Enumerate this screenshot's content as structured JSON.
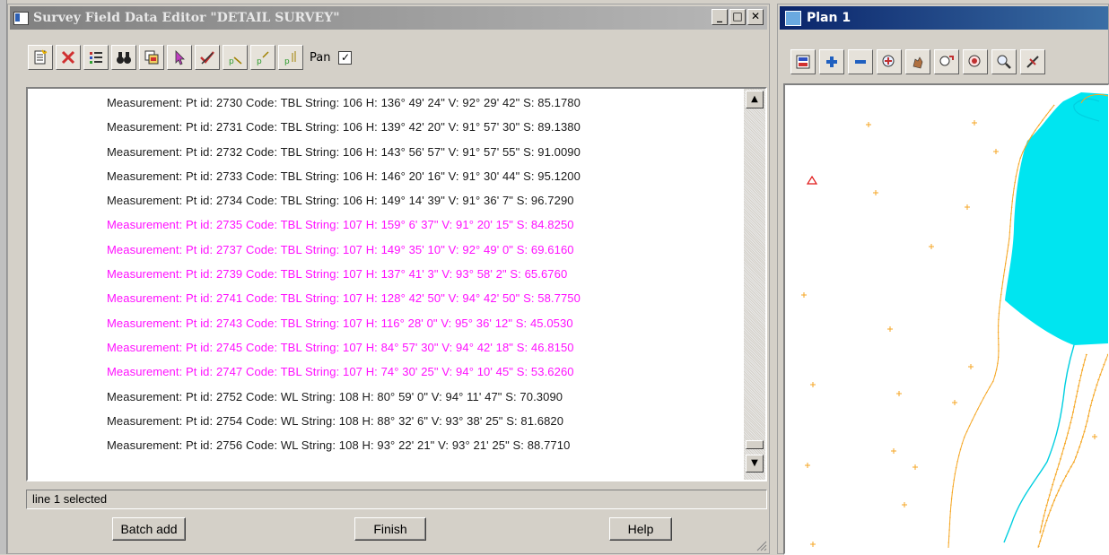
{
  "editor": {
    "title": "Survey Field Data Editor \"DETAIL SURVEY\"",
    "window_buttons": {
      "minimize": "_",
      "maximize": "□",
      "close": "✕"
    },
    "toolbar": {
      "buttons": [
        "new-icon",
        "delete-icon",
        "list-icon",
        "binoculars-icon",
        "copy-icon",
        "cursor-icon",
        "check-icon",
        "point-icon",
        "point-edit-icon",
        "point-chart-icon"
      ],
      "pan_label": "Pan",
      "pan_checked": "✓"
    },
    "rows": [
      {
        "text": "Measurement:  Pt id: 2730 Code: TBL String: 106 H:  136° 49' 24\" V:   92° 29' 42\" S: 85.1780",
        "color": "black"
      },
      {
        "text": "Measurement:  Pt id: 2731 Code: TBL String: 106 H:  139° 42' 20\" V:   91° 57' 30\" S: 89.1380",
        "color": "black"
      },
      {
        "text": "Measurement:  Pt id: 2732 Code: TBL String: 106 H:  143° 56' 57\" V:   91° 57' 55\" S: 91.0090",
        "color": "black"
      },
      {
        "text": "Measurement:  Pt id: 2733 Code: TBL String: 106 H:  146° 20' 16\" V:   91° 30' 44\" S: 95.1200",
        "color": "black"
      },
      {
        "text": "Measurement:  Pt id: 2734 Code: TBL String: 106 H:  149° 14' 39\" V:   91° 36'  7\" S: 96.7290",
        "color": "black"
      },
      {
        "text": "Measurement:  Pt id: 2735 Code: TBL String: 107 H:  159°  6' 37\" V:   91° 20' 15\" S: 84.8250",
        "color": "magenta"
      },
      {
        "text": "Measurement:  Pt id: 2737 Code: TBL String: 107 H:  149° 35' 10\" V:   92° 49'  0\" S: 69.6160",
        "color": "magenta"
      },
      {
        "text": "Measurement:  Pt id: 2739 Code: TBL String: 107 H:  137° 41'  3\" V:   93° 58'  2\" S: 65.6760",
        "color": "magenta"
      },
      {
        "text": "Measurement:  Pt id: 2741 Code: TBL String: 107 H:  128° 42' 50\" V:   94° 42' 50\" S: 58.7750",
        "color": "magenta"
      },
      {
        "text": "Measurement:  Pt id: 2743 Code: TBL String: 107 H:  116° 28'  0\" V:   95° 36' 12\" S: 45.0530",
        "color": "magenta"
      },
      {
        "text": "Measurement:  Pt id: 2745 Code: TBL String: 107 H:   84° 57' 30\" V:   94° 42' 18\" S: 46.8150",
        "color": "magenta"
      },
      {
        "text": "Measurement:  Pt id: 2747 Code: TBL String: 107 H:   74° 30' 25\" V:   94° 10' 45\" S: 53.6260",
        "color": "magenta"
      },
      {
        "text": "Measurement:  Pt id: 2752 Code: WL String: 108 H:   80° 59'  0\" V:   94° 11' 47\" S: 70.3090",
        "color": "black"
      },
      {
        "text": "Measurement:  Pt id: 2754 Code: WL String: 108 H:   88° 32'  6\" V:   93° 38' 25\" S: 81.6820",
        "color": "black"
      },
      {
        "text": "Measurement:  Pt id: 2756 Code: WL String: 108 H:   93° 22' 21\" V:   93° 21' 25\" S: 88.7710",
        "color": "black"
      }
    ],
    "scroll_up": "▲",
    "scroll_down": "▼",
    "status": "line 1 selected",
    "buttons": {
      "batch_add": "Batch add",
      "finish": "Finish",
      "help": "Help"
    }
  },
  "plan": {
    "title": "Plan 1",
    "toolbar": [
      "plan-icon",
      "plus-icon",
      "minus-icon",
      "zoom-in-icon",
      "pan-hand-icon",
      "zoom-extents-icon",
      "zoom-window-icon",
      "zoom-icon",
      "pick-icon"
    ]
  },
  "colors": {
    "magenta_text": "#ff10ff",
    "water": "#00e5f0",
    "string_orange": "#f5a623",
    "plan_title_blue": "#0a246a",
    "triangle_red": "#e01818"
  }
}
